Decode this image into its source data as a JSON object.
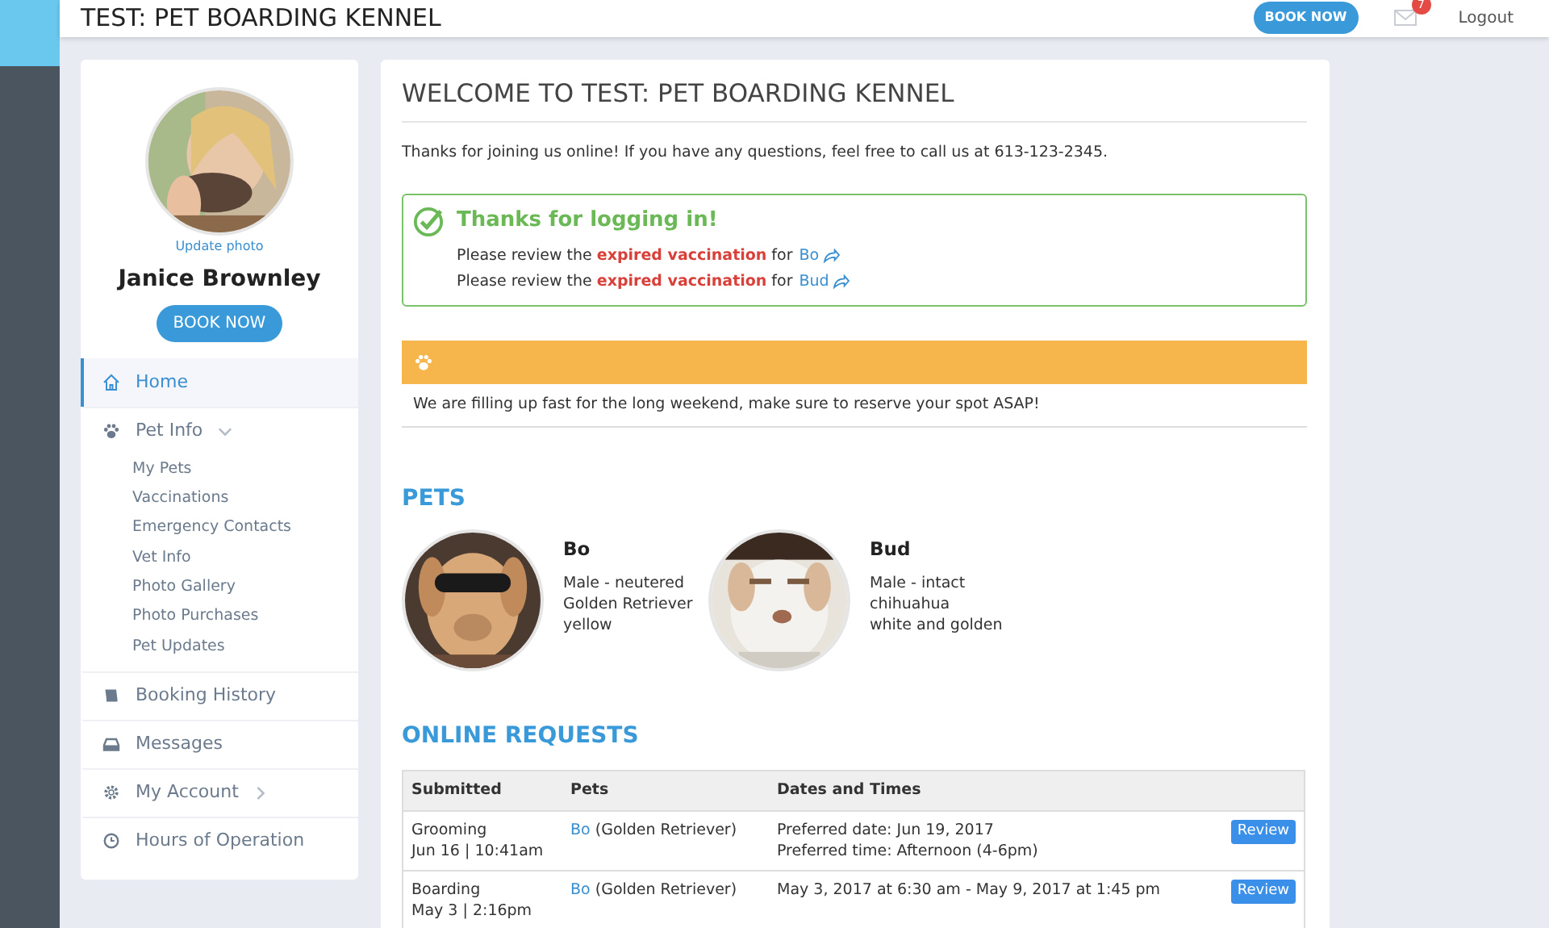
{
  "header": {
    "title": "TEST: PET BOARDING KENNEL",
    "book_button": "BOOK NOW",
    "mail_count": "7",
    "logout": "Logout"
  },
  "profile": {
    "update_photo": "Update photo",
    "name": "Janice Brownley",
    "book_button": "BOOK NOW"
  },
  "sidebar": {
    "items": [
      {
        "label": "Home",
        "selected": true
      },
      {
        "label": "Pet Info",
        "selected": false,
        "expanded": true,
        "children": [
          {
            "label": "My Pets"
          },
          {
            "label": "Vaccinations"
          },
          {
            "label": "Emergency Contacts"
          },
          {
            "label": "Vet Info"
          },
          {
            "label": "Photo Gallery"
          },
          {
            "label": "Photo Purchases"
          },
          {
            "label": "Pet Updates"
          }
        ]
      },
      {
        "label": "Booking History",
        "selected": false
      },
      {
        "label": "Messages",
        "selected": false
      },
      {
        "label": "My Account",
        "selected": false,
        "expanded": false
      },
      {
        "label": "Hours of Operation",
        "selected": false
      }
    ]
  },
  "main": {
    "title": "WELCOME TO TEST: PET BOARDING KENNEL",
    "intro": "Thanks for joining us online! If you have any questions, feel free to call us at 613-123-2345.",
    "success_alert": {
      "title": "Thanks for logging in!",
      "messages": [
        {
          "before": "Please review the",
          "highlight": "expired vaccination",
          "middle": "for",
          "pet": "Bo"
        },
        {
          "before": "Please review the",
          "highlight": "expired vaccination",
          "middle": "for",
          "pet": "Bud"
        }
      ]
    },
    "notice": {
      "text": "We are filling up fast for the long weekend, make sure to reserve your spot ASAP!"
    },
    "pets_heading": "PETS",
    "pets": [
      {
        "name": "Bo",
        "lines": [
          "Male - neutered",
          "Golden Retriever",
          "yellow"
        ],
        "kind": "picture"
      },
      {
        "name": "Bud",
        "lines": [
          "Male - intact",
          "chihuahua",
          "white and golden"
        ],
        "kind": "picture"
      }
    ],
    "requests_heading": "ONLINE REQUESTS",
    "table": {
      "columns": [
        "Submitted",
        "Pets",
        "Dates and Times"
      ],
      "rows": [
        {
          "submitted": [
            "Grooming",
            "Jun 16 | 10:41am"
          ],
          "pet": "Bo",
          "breed": "(Golden Retriever)",
          "dates": [
            "Preferred date: Jun 19, 2017",
            "Preferred time: Afternoon (4-6pm)"
          ],
          "action": "Review"
        },
        {
          "submitted": [
            "Boarding",
            "May 3 | 2:16pm"
          ],
          "pet": "Bo",
          "breed": "(Golden Retriever)",
          "dates": [
            "May 3, 2017 at 6:30 am - May 9, 2017 at 1:45 pm"
          ],
          "action": "Review"
        }
      ]
    }
  }
}
